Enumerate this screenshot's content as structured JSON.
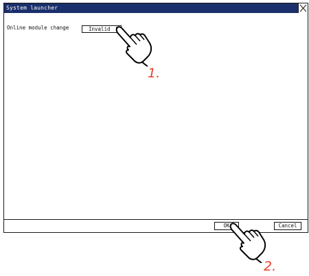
{
  "window": {
    "title": "System launcher"
  },
  "settings": {
    "online_module_change": {
      "label": "Online module change",
      "value": "Invalid"
    }
  },
  "buttons": {
    "ok": "OK",
    "cancel": "Cancel"
  },
  "annotations": {
    "step1": "1.",
    "step2": "2."
  },
  "colors": {
    "titlebar": "#1a2f6b",
    "annotation": "#e8412b"
  },
  "icons": {
    "close": "close-icon",
    "dropdown": "dropdown-arrow-icon",
    "pointer": "pointing-hand-icon"
  }
}
